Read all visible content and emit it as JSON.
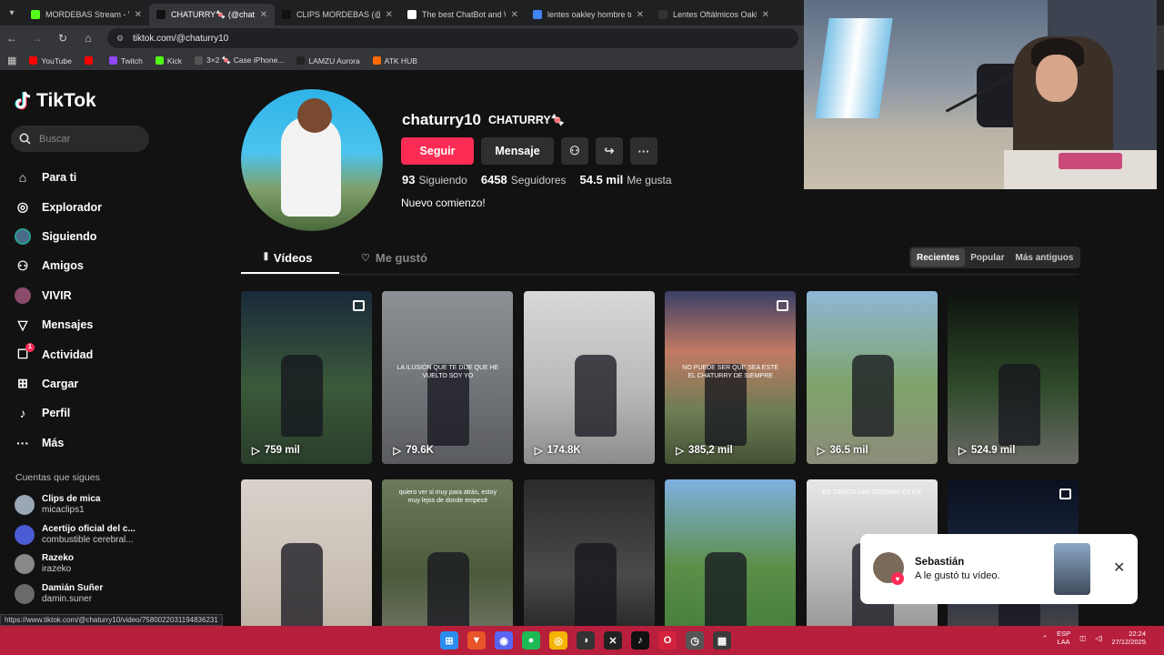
{
  "browser": {
    "tabs": [
      {
        "title": "MORDEBAS Stream - Wat",
        "color": "#53fc18",
        "active": false
      },
      {
        "title": "CHATURRY🍬 (@chaturr",
        "color": "#111111",
        "active": true
      },
      {
        "title": "CLIPS MORDEBAS (@clip",
        "color": "#111111",
        "active": false
      },
      {
        "title": "The best ChatBot and Wi",
        "color": "#ffffff",
        "active": false
      },
      {
        "title": "lentes oakley hombre tra",
        "color": "#4285f4",
        "active": false
      },
      {
        "title": "Lentes Oftálmicos Oakley",
        "color": "#333333",
        "active": false
      }
    ],
    "url": "tiktok.com/@chaturry10",
    "bookmarks": [
      {
        "label": "YouTube",
        "color": "#ff0000"
      },
      {
        "label": "",
        "color": "#ff0000"
      },
      {
        "label": "Twitch",
        "color": "#9146ff"
      },
      {
        "label": "Kick",
        "color": "#53fc18"
      },
      {
        "label": "3×2 🍬 Case iPhone...",
        "color": "#555555"
      },
      {
        "label": "LAMZU Aurora",
        "color": "#222222"
      },
      {
        "label": "ATK HUB",
        "color": "#ff6a00"
      }
    ]
  },
  "tiktok": {
    "brand": "TikTok",
    "search_placeholder": "Buscar",
    "menu": [
      {
        "label": "Para ti",
        "icon": "home-icon",
        "glyph": "⌂"
      },
      {
        "label": "Explorador",
        "icon": "compass-icon",
        "glyph": "◎"
      },
      {
        "label": "Siguiendo",
        "icon": "following-avatar-icon",
        "glyph": "●"
      },
      {
        "label": "Amigos",
        "icon": "friends-icon",
        "glyph": "⚇"
      },
      {
        "label": "VIVIR",
        "icon": "live-icon",
        "glyph": "●"
      },
      {
        "label": "Mensajes",
        "icon": "messages-icon",
        "glyph": "▽"
      },
      {
        "label": "Actividad",
        "icon": "activity-icon",
        "glyph": "☐",
        "badge": "1"
      },
      {
        "label": "Cargar",
        "icon": "upload-icon",
        "glyph": "⊞"
      },
      {
        "label": "Perfil",
        "icon": "profile-icon",
        "glyph": "♪"
      },
      {
        "label": "Más",
        "icon": "more-icon",
        "glyph": "···"
      }
    ],
    "following_header": "Cuentas que sigues",
    "following": [
      {
        "name": "Clips de mica",
        "handle": "micaclips1",
        "color": "#9aa7b4"
      },
      {
        "name": "Acertijo oficial del c...",
        "handle": "combustible cerebral...",
        "color": "#4a5bd4"
      },
      {
        "name": "Razeko",
        "handle": "irazeko",
        "color": "#888888"
      },
      {
        "name": "Damián Suñer",
        "handle": "damin.suner",
        "color": "#6a6a6a"
      }
    ]
  },
  "profile": {
    "handle": "chaturry10",
    "nickname": "CHATURRY🍬",
    "follow_label": "Seguir",
    "message_label": "Mensaje",
    "stats": [
      {
        "value": "93",
        "label": "Siguiendo"
      },
      {
        "value": "6458",
        "label": "Seguidores"
      },
      {
        "value": "54.5 mil",
        "label": "Me gusta"
      }
    ],
    "bio": "Nuevo comienzo!",
    "tab_videos": "Vídeos",
    "tab_liked": "Me gustó",
    "sorts": [
      "Recientes",
      "Popular",
      "Más antiguos"
    ]
  },
  "videos": [
    {
      "views": "759 mil",
      "bg": "linear-gradient(180deg,#1a2a3a,#3a5a3a 55%,#2b3d2b)",
      "photo": true
    },
    {
      "views": "79.6K",
      "bg": "linear-gradient(180deg,#8d9094,#6f7276 60%,#5a5c5f)",
      "photo": false
    },
    {
      "views": "174.8K",
      "bg": "linear-gradient(180deg,#d8d8d8,#b7b7b7 60%,#8d8d8d)",
      "photo": false
    },
    {
      "views": "385,2 mil",
      "bg": "linear-gradient(180deg,#3b3f66,#c27a63 35%,#6b7d54 70%,#455235)",
      "photo": true
    },
    {
      "views": "36.5 mil",
      "bg": "linear-gradient(180deg,#8fb7d6,#7ea36a 55%,#8c8c7a)",
      "photo": false
    },
    {
      "views": "524.9 mil",
      "bg": "linear-gradient(180deg,#0d120e,#2f4a2a 55%,#6a6a66)",
      "photo": false
    },
    {
      "views": "",
      "bg": "linear-gradient(180deg,#d9d2ca,#c9bfb4 60%,#b8ab9e)",
      "photo": false
    },
    {
      "views": "",
      "bg": "linear-gradient(180deg,#6d7b5d,#4a5a3a 55%,#7a7a70)",
      "photo": false
    },
    {
      "views": "",
      "bg": "linear-gradient(180deg,#2b2b2b,#4a4a4a 55%,#1c1c1c)",
      "photo": false
    },
    {
      "views": "",
      "bg": "linear-gradient(180deg,#7fb0e0,#5c8f4a 50%,#3f7a3a)",
      "photo": false
    },
    {
      "views": "",
      "bg": "linear-gradient(180deg,#e8e8e8,#b8b8b8 55%,#8a8a8a)",
      "photo": false
    },
    {
      "views": "",
      "bg": "linear-gradient(180deg,#0a1020,#1d2a44 55%,#5a5048)",
      "photo": true
    }
  ],
  "overlay_texts": [
    "",
    "LA ILUSIÓN QUE TE DIJE QUE HE VUELTO SOY YO",
    "",
    "NO PUEDE SER QUE SEA ESTE EL CHATURRY DE SIEMPRE",
    "",
    "",
    "",
    "quiero ver si muy para atrás, estoy muy lejos de donde empecé",
    "",
    "",
    "ES ZAPATILLAS ORIGINALES EN",
    ""
  ],
  "toast": {
    "name": "Sebastián",
    "message": "A le gustó tu vídeo."
  },
  "status_url": "https://www.tiktok.com/@chaturry10/video/7580022031194836231",
  "taskbar": {
    "apps": [
      {
        "name": "start-icon",
        "glyph": "⊞",
        "color": "#2b8df0"
      },
      {
        "name": "brave-icon",
        "glyph": "▼",
        "color": "#e8552a"
      },
      {
        "name": "discord-icon",
        "glyph": "◉",
        "color": "#5865f2"
      },
      {
        "name": "spotify-icon",
        "glyph": "●",
        "color": "#1db954"
      },
      {
        "name": "chrome-icon",
        "glyph": "◎",
        "color": "#f4b400"
      },
      {
        "name": "obs-icon",
        "glyph": "◑",
        "color": "#333333"
      },
      {
        "name": "capcut-icon",
        "glyph": "✕",
        "color": "#222222"
      },
      {
        "name": "tiktok-icon",
        "glyph": "♪",
        "color": "#111111"
      },
      {
        "name": "opera-icon",
        "glyph": "O",
        "color": "#d4223c"
      },
      {
        "name": "timer-icon",
        "glyph": "◷",
        "color": "#555555"
      },
      {
        "name": "calculator-icon",
        "glyph": "▦",
        "color": "#3a3a3a"
      }
    ],
    "lang": "ESP",
    "lang2": "LAA",
    "time": "22:24",
    "date": "27/12/2025"
  }
}
